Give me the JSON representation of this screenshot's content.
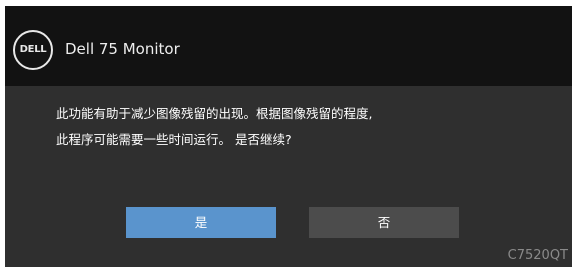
{
  "header": {
    "logo_text": "DELL",
    "title": "Dell 75 Monitor"
  },
  "dialog": {
    "message_line_1": "此功能有助于减少图像残留的出现。根据图像残留的程度,",
    "message_line_2": "此程序可能需要一些时间运行。 是否继续?"
  },
  "buttons": {
    "yes_label": "是",
    "no_label": "否",
    "selected": "yes"
  },
  "footer": {
    "model": "C7520QT"
  },
  "colors": {
    "header_bg": "#121212",
    "body_bg": "#2f2f2f",
    "selected_button": "#5a94cd",
    "unselected_button": "#4c4c4c",
    "model_text": "#8a8a8a"
  },
  "icons": {
    "logo": "dell-logo-icon"
  }
}
